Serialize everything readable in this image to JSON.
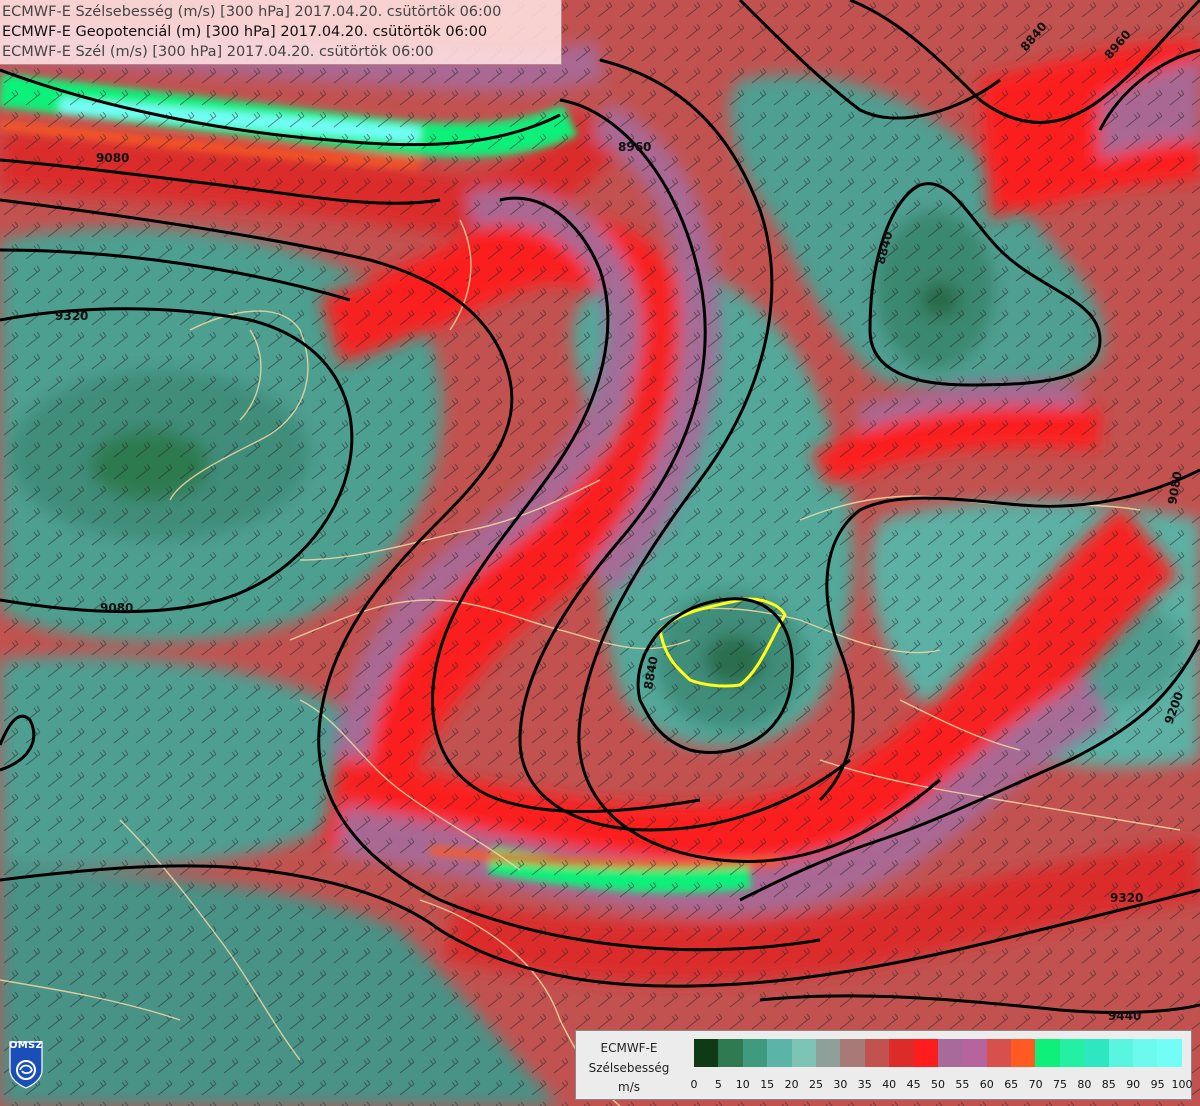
{
  "header": {
    "line1": "ECMWF-E Szélsebesség (m/s) [300 hPa] 2017.04.20. csütörtök 06:00",
    "line2": "ECMWF-E Geopotenciál (m) [300 hPa] 2017.04.20. csütörtök 06:00",
    "line3": "ECMWF-E Szél (m/s) [300 hPa] 2017.04.20. csütörtök 06:00"
  },
  "logo": {
    "text": "OMSZ",
    "icon": "omsz-logo-icon"
  },
  "legend": {
    "title_line1": "ECMWF-E",
    "title_line2": "Szélsebesség",
    "title_line3": "m/s",
    "colors": [
      "#0e3a16",
      "#2f7a50",
      "#3f9a7e",
      "#5cb4a8",
      "#7ec4b4",
      "#8fa09a",
      "#a77a78",
      "#c25250",
      "#dd2b2a",
      "#ff1c1c",
      "#a86a98",
      "#b6649e",
      "#d8504c",
      "#ff5a22",
      "#0ff07a",
      "#24f0a4",
      "#2ee6c0",
      "#5af5e0",
      "#6cf9ee",
      "#72fdf6",
      "#7afffb"
    ],
    "ticks": [
      "0",
      "5",
      "10",
      "15",
      "20",
      "25",
      "30",
      "35",
      "40",
      "45",
      "50",
      "55",
      "60",
      "65",
      "70",
      "75",
      "80",
      "85",
      "90",
      "95",
      "100"
    ]
  },
  "contours": {
    "label_8840": "8840",
    "label_8960": "8960",
    "label_9080": "9080",
    "label_9200": "9200",
    "label_9320": "9320",
    "label_9440": "9440"
  }
}
